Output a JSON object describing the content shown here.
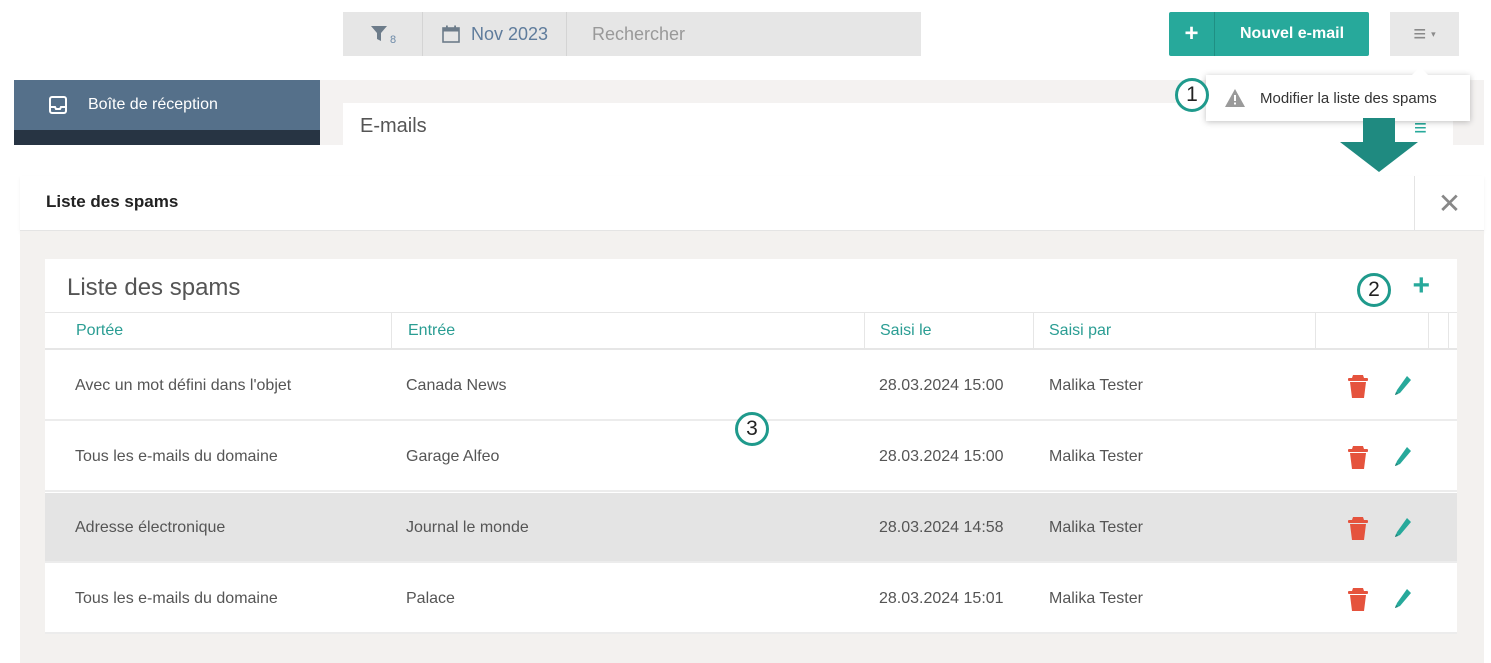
{
  "toolbar": {
    "filter_count": "8",
    "date_label": "Nov 2023",
    "search_placeholder": "Rechercher",
    "new_mail_label": "Nouvel e-mail",
    "new_mail_plus": "+"
  },
  "sidebar": {
    "inbox_label": "Boîte de réception"
  },
  "background_card": {
    "title": "E-mails"
  },
  "popup": {
    "label": "Modifier la liste des spams"
  },
  "callouts": [
    "1",
    "2",
    "3"
  ],
  "modal": {
    "title": "Liste des spams",
    "close": "✕",
    "card_title": "Liste des spams",
    "add": "+"
  },
  "table": {
    "columns": [
      "Portée",
      "Entrée",
      "Saisi le",
      "Saisi par"
    ],
    "rows": [
      {
        "portee": "Avec un mot défini dans l'objet",
        "entree": "Canada News",
        "date": "28.03.2024 15:00",
        "par": "Malika Tester"
      },
      {
        "portee": "Tous les e-mails du domaine",
        "entree": "Garage Alfeo",
        "date": "28.03.2024 15:00",
        "par": "Malika Tester"
      },
      {
        "portee": "Adresse électronique",
        "entree": "Journal le monde",
        "date": "28.03.2024 14:58",
        "par": "Malika Tester"
      },
      {
        "portee": "Tous les e-mails du domaine",
        "entree": "Palace",
        "date": "28.03.2024 15:01",
        "par": "Malika Tester"
      }
    ],
    "selected_row": 2
  },
  "colors": {
    "accent": "#27a99b",
    "delete": "#e5533d",
    "sidebar_active": "#55708a",
    "sidebar_dark": "#273443"
  },
  "icons": [
    "filter-icon",
    "calendar-icon",
    "plus-icon",
    "hamburger-menu-icon",
    "inbox-icon",
    "warning-icon",
    "close-icon",
    "trash-icon",
    "pencil-icon",
    "arrow-down-icon"
  ]
}
